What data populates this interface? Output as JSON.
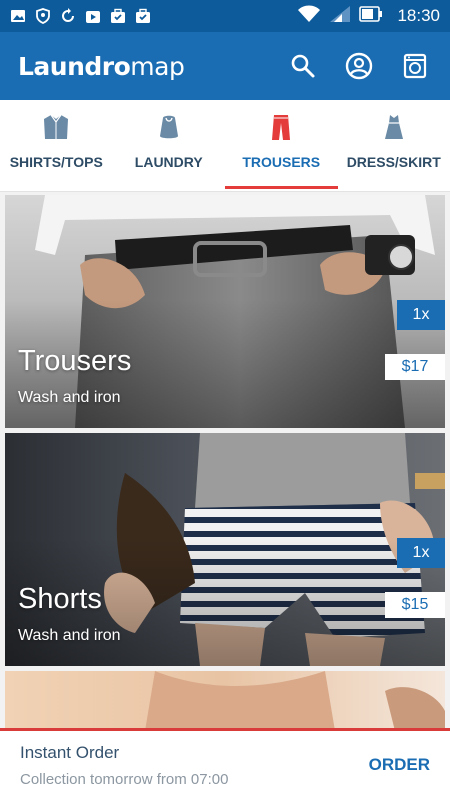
{
  "status_bar": {
    "time": "18:30",
    "icons": [
      "image-icon",
      "shield-icon",
      "sync-icon",
      "play-store-icon",
      "briefcase-check-icon",
      "briefcase-check-icon",
      "wifi-icon",
      "signal-icon",
      "battery-icon"
    ]
  },
  "app_bar": {
    "logo_bold": "Laundro",
    "logo_light": "map",
    "actions": [
      "search-icon",
      "account-icon",
      "washing-machine-icon"
    ]
  },
  "tabs": [
    {
      "label": "SHIRTS/TOPS",
      "icon": "shirt-icon",
      "active": false
    },
    {
      "label": "LAUNDRY",
      "icon": "laundry-bag-icon",
      "active": false
    },
    {
      "label": "TROUSERS",
      "icon": "trousers-icon",
      "active": true
    },
    {
      "label": "DRESS/SKIRT",
      "icon": "dress-icon",
      "active": false
    }
  ],
  "cards": [
    {
      "title": "Trousers",
      "subtitle": "Wash and iron",
      "quantity": "1x",
      "price": "$17"
    },
    {
      "title": "Shorts",
      "subtitle": "Wash and iron",
      "quantity": "1x",
      "price": "$15"
    }
  ],
  "bottom_bar": {
    "title": "Instant Order",
    "subtitle": "Collection tomorrow from 07:00",
    "order_label": "ORDER"
  },
  "colors": {
    "status_bar": "#0d5b9a",
    "app_bar": "#1b6db3",
    "accent_red": "#e43b3b",
    "tab_text": "#2e4c66"
  }
}
